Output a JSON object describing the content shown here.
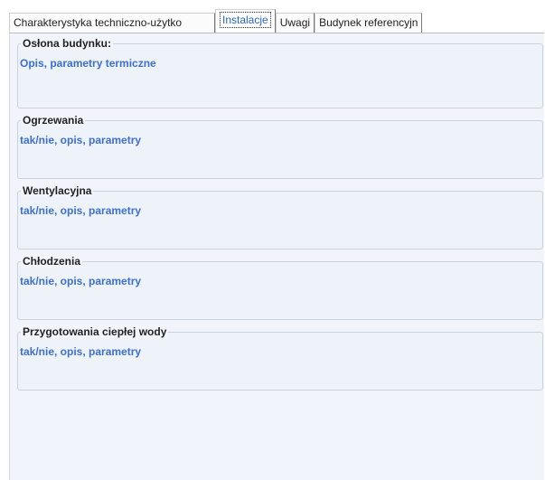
{
  "tabs": [
    {
      "label": "Charakterystyka techniczno-użytko"
    },
    {
      "label": "Instalacje",
      "active": true
    },
    {
      "label": "Uwagi"
    },
    {
      "label": "Budynek referencyjn"
    }
  ],
  "groups": [
    {
      "title": "Osłona budynku:",
      "value": "Opis, parametry termiczne"
    },
    {
      "title": "Ogrzewania",
      "value": "tak/nie, opis, parametry"
    },
    {
      "title": "Wentylacyjna",
      "value": "tak/nie, opis, parametry"
    },
    {
      "title": "Chłodzenia",
      "value": "tak/nie, opis, parametry"
    },
    {
      "title": "Przygotowania ciepłej wody",
      "value": "tak/nie, opis, parametry"
    }
  ],
  "colors": {
    "panel_background": "#f1f5fb",
    "value_text": "#3d6fd4",
    "active_tab_text": "#2c64c6"
  }
}
